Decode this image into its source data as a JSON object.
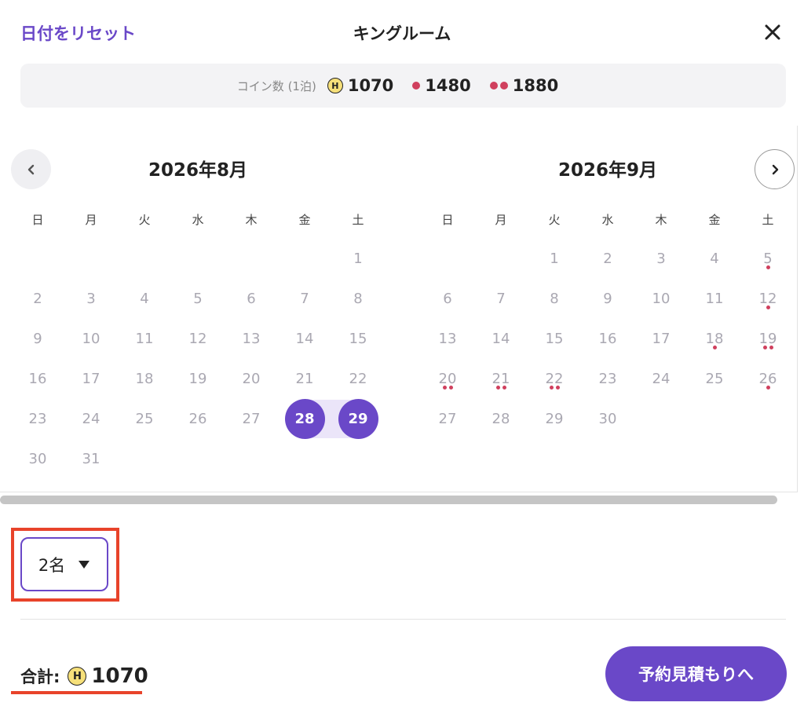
{
  "header": {
    "reset_label": "日付をリセット",
    "room_title": "キングルーム"
  },
  "coin_bar": {
    "label": "コイン数 (1泊)",
    "coin_symbol": "H",
    "prices": [
      {
        "marker": "coin",
        "value": "1070"
      },
      {
        "marker": "one-dot",
        "value": "1480"
      },
      {
        "marker": "two-dots",
        "value": "1880"
      }
    ]
  },
  "calendar": {
    "weekdays": [
      "日",
      "月",
      "火",
      "水",
      "木",
      "金",
      "土"
    ],
    "months": [
      {
        "title": "2026年8月",
        "first_weekday": 6,
        "days": 31,
        "marks": {},
        "selected_range": [
          28,
          29
        ]
      },
      {
        "title": "2026年9月",
        "first_weekday": 2,
        "days": 30,
        "marks": {
          "5": 1,
          "12": 1,
          "18": 1,
          "19": 2,
          "20": 2,
          "21": 2,
          "22": 2,
          "26": 1
        },
        "selected_range": []
      }
    ]
  },
  "guests": {
    "value": "2名"
  },
  "total": {
    "label": "合計:",
    "coin_symbol": "H",
    "amount": "1070"
  },
  "quote_button": {
    "label": "予約見積もりへ"
  },
  "colors": {
    "accent": "#6a48c8",
    "range_fill": "#ebe5f9",
    "price_dot": "#d0405e",
    "highlight": "#e8432a"
  }
}
